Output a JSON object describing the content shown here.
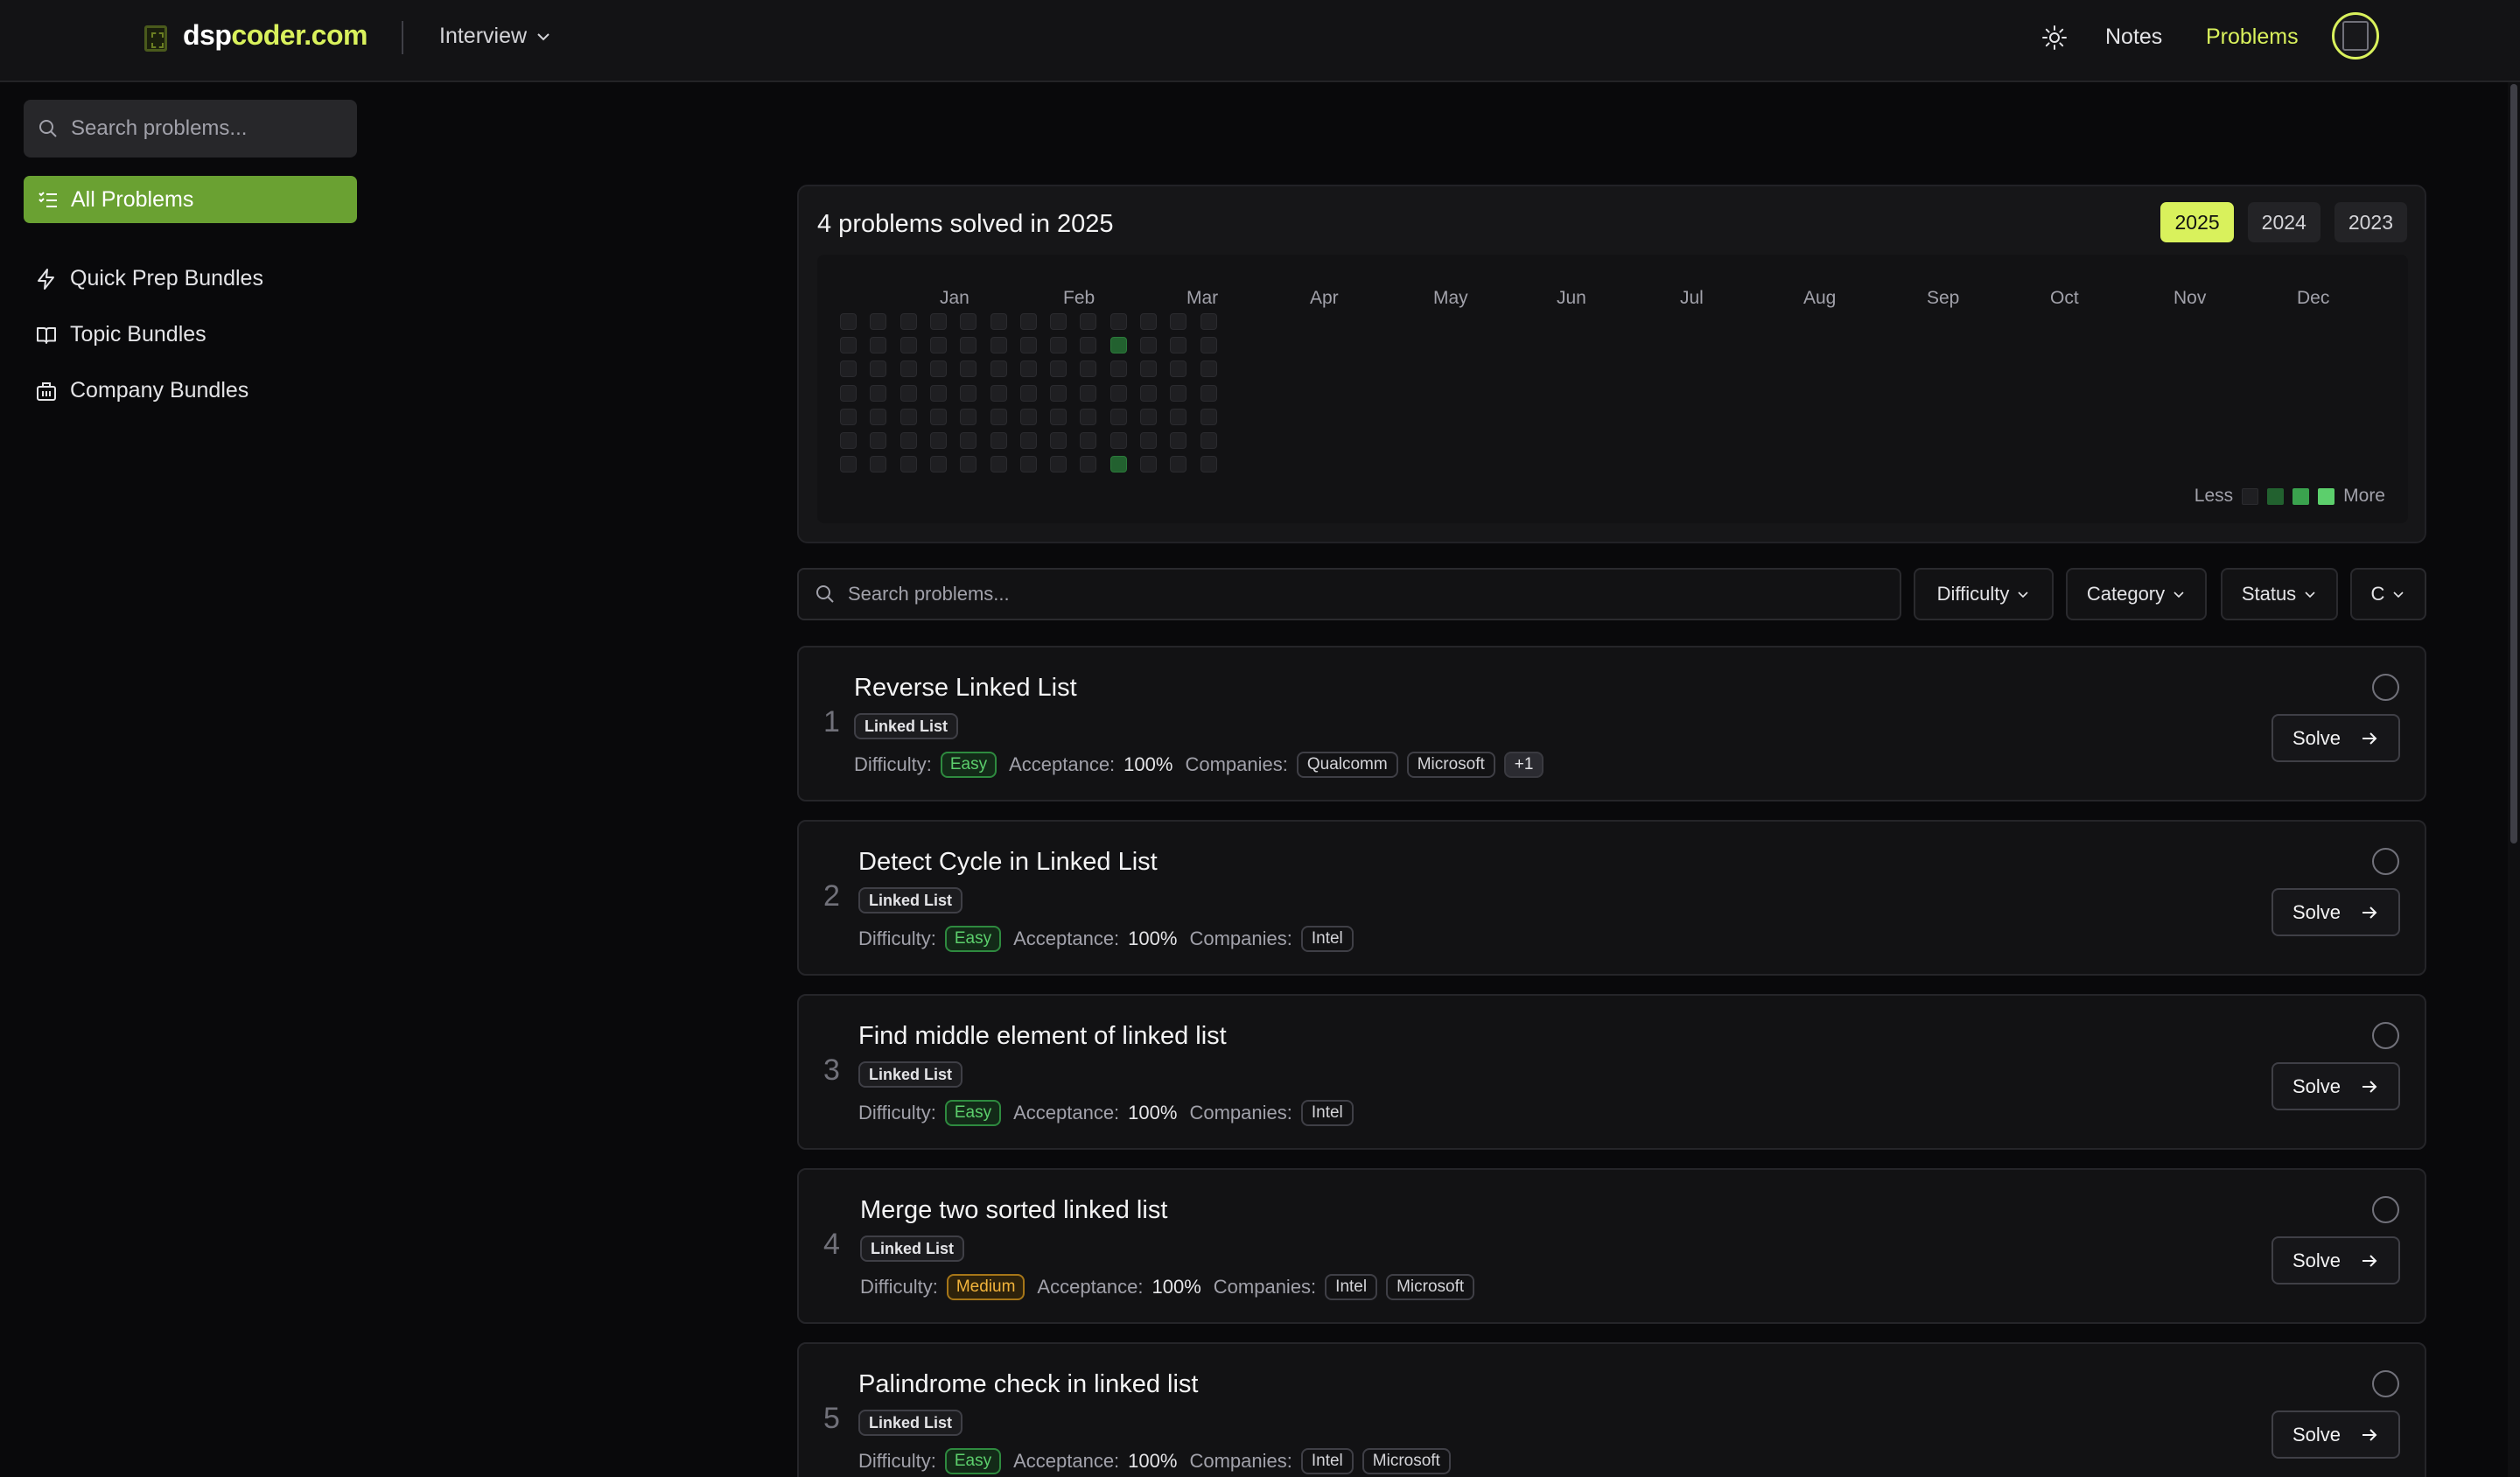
{
  "header": {
    "logo_main": "dsp",
    "logo_accent": "coder.com",
    "mode_menu": "Interview",
    "nav_notes": "Notes",
    "nav_problems": "Problems",
    "accent_color": "#d9f15c"
  },
  "sidebar": {
    "search_placeholder": "Search problems...",
    "all_problems": "All Problems",
    "items": [
      {
        "label": "Quick Prep Bundles",
        "icon": "lightning-icon"
      },
      {
        "label": "Topic Bundles",
        "icon": "book-icon"
      },
      {
        "label": "Company Bundles",
        "icon": "building-icon"
      }
    ]
  },
  "activity": {
    "title": "4 problems solved in 2025",
    "years": [
      "2025",
      "2024",
      "2023"
    ],
    "selected_year": "2025",
    "months": [
      "Jan",
      "Feb",
      "Mar",
      "Apr",
      "May",
      "Jun",
      "Jul",
      "Aug",
      "Sep",
      "Oct",
      "Nov",
      "Dec"
    ],
    "legend_less": "Less",
    "legend_more": "More",
    "legend_colors": [
      "#1f1f22",
      "#22612f",
      "#3aa24e",
      "#5ccf6c"
    ],
    "active_cells": [
      {
        "week": 9,
        "day": 1,
        "level": 2
      },
      {
        "week": 9,
        "day": 6,
        "level": 2
      }
    ]
  },
  "filters": {
    "search_placeholder": "Search problems...",
    "difficulty": "Difficulty",
    "category": "Category",
    "status": "Status",
    "companies_truncated": "C"
  },
  "problems": [
    {
      "num": "1",
      "title": "Reverse Linked List",
      "topic": "Linked List",
      "difficulty": "Easy",
      "acceptance": "100%",
      "companies": [
        "Qualcomm",
        "Microsoft"
      ],
      "more": "+1"
    },
    {
      "num": "2",
      "title": "Detect Cycle in Linked List",
      "topic": "Linked List",
      "difficulty": "Easy",
      "acceptance": "100%",
      "companies": [
        "Intel"
      ],
      "more": ""
    },
    {
      "num": "3",
      "title": "Find middle element of linked list",
      "topic": "Linked List",
      "difficulty": "Easy",
      "acceptance": "100%",
      "companies": [
        "Intel"
      ],
      "more": ""
    },
    {
      "num": "4",
      "title": "Merge two sorted linked list",
      "topic": "Linked List",
      "difficulty": "Medium",
      "acceptance": "100%",
      "companies": [
        "Intel",
        "Microsoft"
      ],
      "more": ""
    },
    {
      "num": "5",
      "title": "Palindrome check in linked list",
      "topic": "Linked List",
      "difficulty": "Easy",
      "acceptance": "100%",
      "companies": [
        "Intel",
        "Microsoft"
      ],
      "more": ""
    }
  ],
  "labels": {
    "difficulty": "Difficulty:",
    "acceptance": "Acceptance:",
    "companies": "Companies:",
    "solve": "Solve"
  }
}
